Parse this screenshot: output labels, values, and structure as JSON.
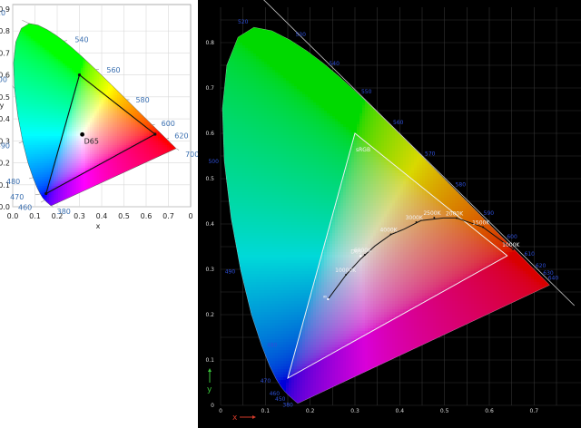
{
  "chart_data": [
    {
      "type": "scatter",
      "title": "",
      "xlabel": "x",
      "ylabel": "y",
      "xlim": [
        0,
        0.8
      ],
      "ylim": [
        0,
        0.85
      ],
      "x_ticks": [
        "0.0",
        "0.1",
        "0.2",
        "0.3",
        "0.4",
        "0.5",
        "0.6",
        "0.7",
        "0",
        "0"
      ],
      "y_ticks": [
        "0.0",
        "0.1",
        "0.2",
        "0.3",
        "0.4",
        "0.5",
        "0.6",
        "0.7",
        "0.8",
        "0.9"
      ],
      "wavelength_labels": [
        {
          "label": "520",
          "x": 0.074,
          "y": 0.834
        },
        {
          "label": "540",
          "x": 0.23,
          "y": 0.754
        },
        {
          "label": "560",
          "x": 0.373,
          "y": 0.624
        },
        {
          "label": "580",
          "x": 0.512,
          "y": 0.487
        },
        {
          "label": "600",
          "x": 0.627,
          "y": 0.372
        },
        {
          "label": "620",
          "x": 0.691,
          "y": 0.308
        },
        {
          "label": "700",
          "x": 0.735,
          "y": 0.265
        },
        {
          "label": "500",
          "x": 0.008,
          "y": 0.538
        },
        {
          "label": "490",
          "x": 0.045,
          "y": 0.295
        },
        {
          "label": "480",
          "x": 0.091,
          "y": 0.133
        },
        {
          "label": "470",
          "x": 0.124,
          "y": 0.058
        },
        {
          "label": "460",
          "x": 0.144,
          "y": 0.03
        },
        {
          "label": "380",
          "x": 0.174,
          "y": 0.005
        }
      ],
      "white_point": {
        "label": "D65",
        "x": 0.3127,
        "y": 0.329
      },
      "triangle": [
        [
          0.64,
          0.33
        ],
        [
          0.3,
          0.6
        ],
        [
          0.15,
          0.06
        ]
      ],
      "grid": true
    },
    {
      "type": "line",
      "title": "",
      "xlabel": "x",
      "ylabel": "y",
      "xlim": [
        0,
        0.75
      ],
      "ylim": [
        0,
        0.85
      ],
      "x_ticks": [
        "0",
        "0.1",
        "0.2",
        "0.3",
        "0.4",
        "0.5",
        "0.6",
        "0.7"
      ],
      "y_ticks": [
        "0",
        "0.1",
        "0.2",
        "0.3",
        "0.4",
        "0.5",
        "0.6",
        "0.7",
        "0.8"
      ],
      "wavelength_labels": [
        {
          "label": "520",
          "x": 0.074,
          "y": 0.834
        },
        {
          "label": "530",
          "x": 0.155,
          "y": 0.806
        },
        {
          "label": "540",
          "x": 0.23,
          "y": 0.754
        },
        {
          "label": "550",
          "x": 0.302,
          "y": 0.692
        },
        {
          "label": "560",
          "x": 0.373,
          "y": 0.624
        },
        {
          "label": "570",
          "x": 0.444,
          "y": 0.555
        },
        {
          "label": "580",
          "x": 0.512,
          "y": 0.487
        },
        {
          "label": "590",
          "x": 0.575,
          "y": 0.424
        },
        {
          "label": "600",
          "x": 0.627,
          "y": 0.372
        },
        {
          "label": "610",
          "x": 0.666,
          "y": 0.334
        },
        {
          "label": "620",
          "x": 0.691,
          "y": 0.308
        },
        {
          "label": "630",
          "x": 0.708,
          "y": 0.292
        },
        {
          "label": "640",
          "x": 0.719,
          "y": 0.281
        },
        {
          "label": "500",
          "x": 0.008,
          "y": 0.538
        },
        {
          "label": "490",
          "x": 0.045,
          "y": 0.295
        },
        {
          "label": "480",
          "x": 0.091,
          "y": 0.133
        },
        {
          "label": "470",
          "x": 0.124,
          "y": 0.058
        },
        {
          "label": "460",
          "x": 0.144,
          "y": 0.03
        },
        {
          "label": "450",
          "x": 0.157,
          "y": 0.018
        },
        {
          "label": "380",
          "x": 0.174,
          "y": 0.005
        }
      ],
      "triangle": [
        [
          0.64,
          0.33
        ],
        [
          0.3,
          0.6
        ],
        [
          0.15,
          0.06
        ]
      ],
      "triangle_label": "sRGB",
      "planckian_locus": [
        [
          0.2399,
          0.2342
        ],
        [
          0.2806,
          0.2883
        ],
        [
          0.3135,
          0.3236
        ],
        [
          0.3447,
          0.3516
        ],
        [
          0.3805,
          0.3768
        ],
        [
          0.4103,
          0.3888
        ],
        [
          0.4474,
          0.4075
        ],
        [
          0.4973,
          0.4133
        ],
        [
          0.5267,
          0.4133
        ],
        [
          0.5857,
          0.3931
        ],
        [
          0.6528,
          0.3444
        ]
      ],
      "cct_labels": [
        {
          "label": "10000K",
          "x": 0.28,
          "y": 0.288
        },
        {
          "label": "6000K",
          "x": 0.322,
          "y": 0.332
        },
        {
          "label": "4000K",
          "x": 0.38,
          "y": 0.377
        },
        {
          "label": "3000K",
          "x": 0.437,
          "y": 0.404
        },
        {
          "label": "2500K",
          "x": 0.477,
          "y": 0.414
        },
        {
          "label": "2000K",
          "x": 0.527,
          "y": 0.413
        },
        {
          "label": "1500K",
          "x": 0.586,
          "y": 0.393
        },
        {
          "label": "1000K",
          "x": 0.653,
          "y": 0.344
        }
      ],
      "d65_label": {
        "label": "D65",
        "x": 0.3127,
        "y": 0.329
      },
      "infinity_label": {
        "label": "∞",
        "x": 0.2399,
        "y": 0.2342
      },
      "grid": true
    }
  ]
}
